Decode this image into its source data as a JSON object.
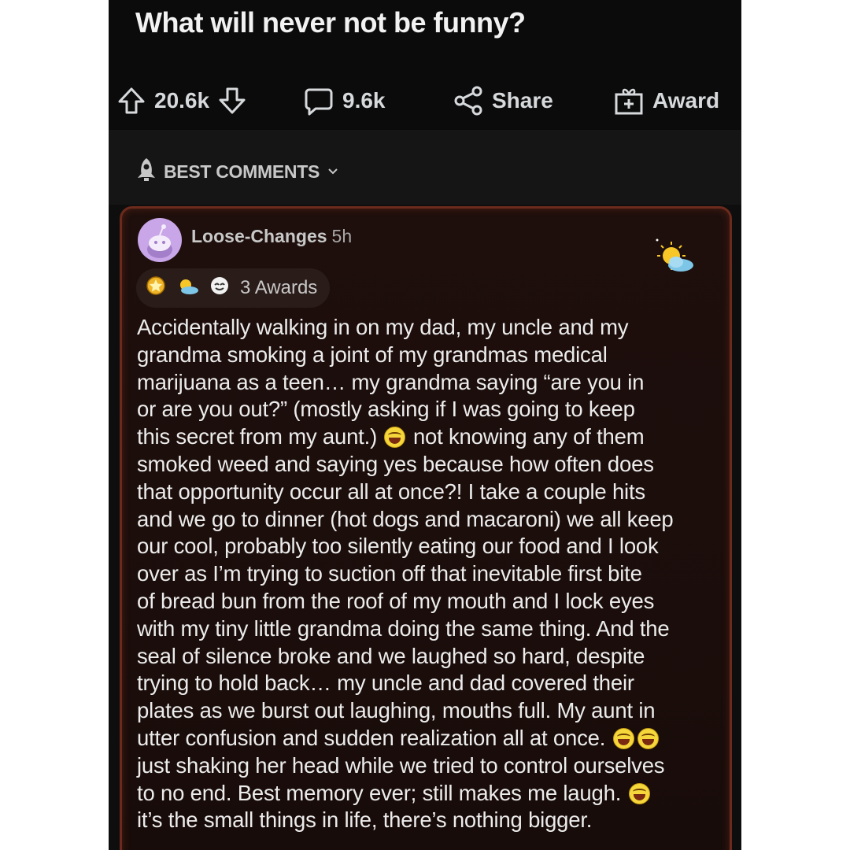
{
  "post": {
    "title": "What will never not be funny?",
    "upvotes": "20.6k",
    "comments": "9.6k",
    "share_label": "Share",
    "award_label": "Award"
  },
  "sort": {
    "label": "BEST COMMENTS"
  },
  "comment": {
    "username": "Loose-Changes",
    "age": "5h",
    "awards_label": "3 Awards",
    "lines": [
      "Accidentally walking in on my dad, my uncle and my",
      "grandma smoking a joint of my grandmas medical",
      "marijuana as a teen… my grandma saying “are you in",
      "or are you out?” (mostly asking if I was going to keep",
      "this secret from my aunt.)",
      "not knowing any of them",
      "smoked weed and saying yes because how often does",
      "that opportunity occur all at once?! I take a couple hits",
      "and we go to dinner (hot dogs and macaroni) we all keep",
      "our cool, probably too silently eating our food and I look",
      "over as I’m trying to suction off that inevitable first bite",
      "of bread bun from the roof of my mouth and I lock eyes",
      "with my tiny little grandma doing the same thing. And the",
      "seal of silence broke and we laughed so hard, despite",
      "trying to hold back… my uncle and dad covered their",
      "plates as we burst out laughing, mouths full. My aunt in",
      "utter confusion and sudden realization all at once.",
      "just shaking her head while we tried to control ourselves",
      "to no end. Best memory ever; still makes me laugh.",
      "it’s the small things in life, there’s nothing bigger."
    ]
  },
  "colors": {
    "background": "#0e0e0e",
    "card_border": "#6b2a1c",
    "text": "#ececec"
  },
  "icons": [
    "upvote-icon",
    "downvote-icon",
    "comment-icon",
    "share-icon",
    "award-icon",
    "rocket-icon",
    "chevron-down-icon",
    "avatar",
    "sun-flair-icon",
    "laughing-emoji-icon"
  ]
}
